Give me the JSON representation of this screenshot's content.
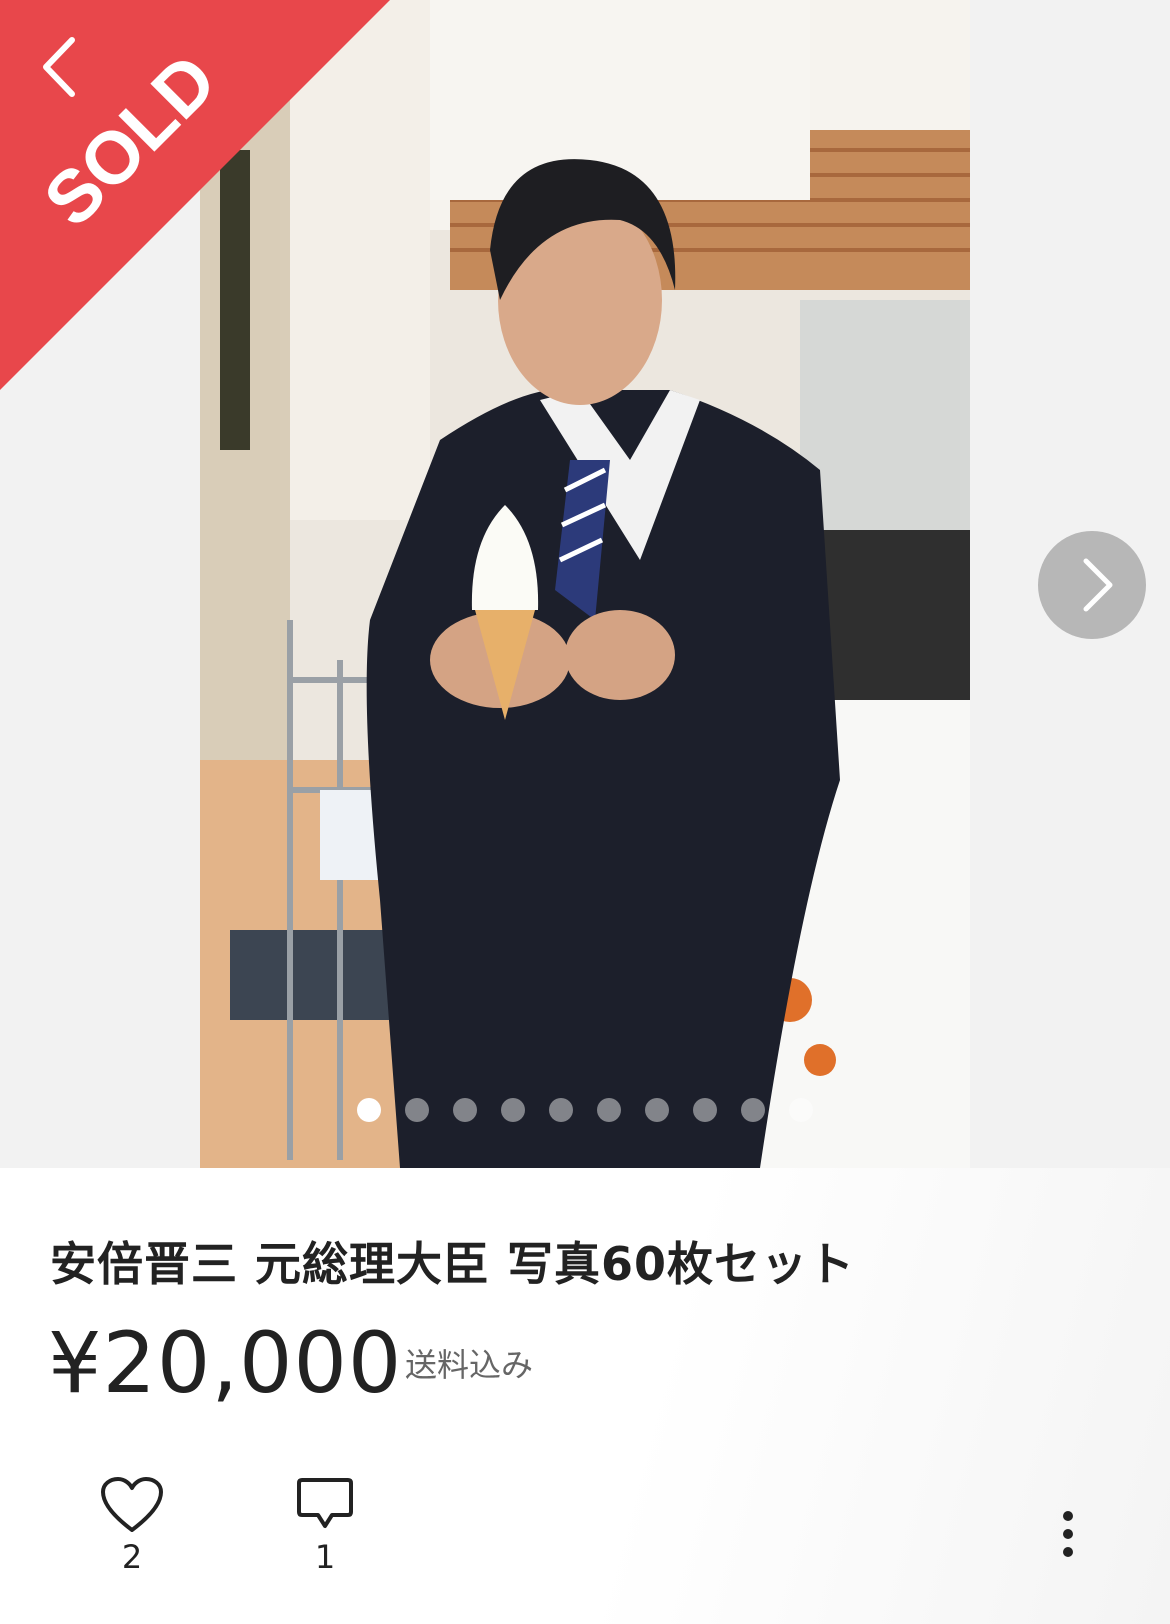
{
  "listing": {
    "status_badge": "SOLD",
    "title": "安倍晋三 元総理大臣 写真60枚セット",
    "price": "¥20,000",
    "shipping_note": "送料込み",
    "likes_count": "2",
    "comments_count": "1"
  },
  "gallery": {
    "image_count": 10,
    "active_index": 0,
    "photo_description_icon": "product-photo"
  },
  "colors": {
    "sold_ribbon": "#e8474b",
    "text_primary": "#222222",
    "text_secondary": "#666666"
  },
  "icons": {
    "back": "chevron-left-icon",
    "next": "chevron-right-icon",
    "like": "heart-icon",
    "comment": "comment-icon",
    "more": "more-vertical-icon"
  }
}
